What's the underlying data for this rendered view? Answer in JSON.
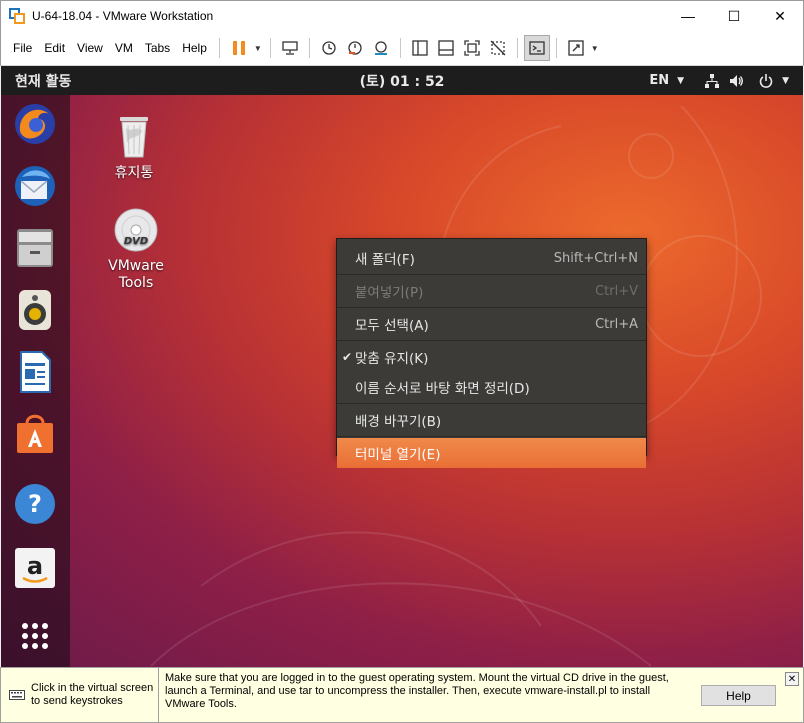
{
  "window": {
    "title": "U-64-18.04 - VMware Workstation",
    "controls": {
      "minimize": "—",
      "maximize": "☐",
      "close": "✕"
    }
  },
  "menu": [
    "File",
    "Edit",
    "View",
    "VM",
    "Tabs",
    "Help"
  ],
  "toolbar": {
    "icons": [
      "pause-icon",
      "send-ctrl-alt-del-icon",
      "snapshot-icon",
      "revert-snapshot-icon",
      "snapshot-manager-icon",
      "library-icon",
      "thumbnail-bar-icon",
      "full-screen-icon",
      "unity-icon",
      "console-view-icon",
      "stretch-icon"
    ],
    "accent": "#f28c1e"
  },
  "guest": {
    "topbar": {
      "activities": "현재 활동",
      "clock": "(토) 01 : 52",
      "lang": "EN"
    },
    "dock": [
      "firefox-icon",
      "thunderbird-icon",
      "files-icon",
      "rhythmbox-icon",
      "libreoffice-writer-icon",
      "software-center-icon",
      "help-icon",
      "amazon-icon",
      "show-apps-icon"
    ],
    "desktop_icons": [
      {
        "label": "휴지통",
        "icon": "trash-icon"
      },
      {
        "label": "VMware Tools",
        "icon": "dvd-icon"
      }
    ],
    "context_menu": [
      {
        "label": "새 폴더(F)",
        "shortcut": "Shift+Ctrl+N",
        "disabled": false
      },
      {
        "label": "붙여넣기(P)",
        "shortcut": "Ctrl+V",
        "disabled": true
      },
      {
        "label": "모두 선택(A)",
        "shortcut": "Ctrl+A",
        "disabled": false
      },
      {
        "label": "맞춤 유지(K)",
        "checked": true
      },
      {
        "label": "이름 순서로 바탕 화면 정리(D)"
      },
      {
        "label": "배경 바꾸기(B)"
      },
      {
        "label": "터미널 열기(E)",
        "highlighted": true
      }
    ]
  },
  "infobar": {
    "hint": "Click in the virtual screen to send keystrokes",
    "message": "Make sure that you are logged in to the guest operating system. Mount the virtual CD drive in the guest, launch a Terminal, and use tar to uncompress the installer. Then, execute vmware-install.pl to install VMware Tools.",
    "help_label": "Help",
    "close": "✕"
  }
}
